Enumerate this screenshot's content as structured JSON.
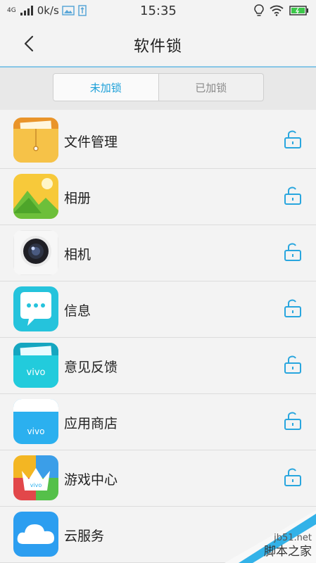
{
  "status_bar": {
    "network": "4G",
    "speed": "0k/s",
    "time": "15:35"
  },
  "header": {
    "title": "软件锁",
    "back_icon": "chevron-left-icon"
  },
  "tabs": [
    {
      "label": "未加锁",
      "active": true
    },
    {
      "label": "已加锁",
      "active": false
    }
  ],
  "apps": [
    {
      "name": "文件管理",
      "icon": "file-manager-icon",
      "locked": false
    },
    {
      "name": "相册",
      "icon": "gallery-icon",
      "locked": false
    },
    {
      "name": "相机",
      "icon": "camera-icon",
      "locked": false
    },
    {
      "name": "信息",
      "icon": "messages-icon",
      "locked": false
    },
    {
      "name": "意见反馈",
      "icon": "feedback-icon",
      "locked": false
    },
    {
      "name": "应用商店",
      "icon": "app-store-icon",
      "locked": false
    },
    {
      "name": "游戏中心",
      "icon": "game-center-icon",
      "locked": false
    },
    {
      "name": "云服务",
      "icon": "cloud-service-icon",
      "locked": false
    }
  ],
  "brand_text": "vivo",
  "watermark": {
    "site": "jb51.net",
    "name": "脚本之家"
  },
  "colors": {
    "accent": "#1a9fd8",
    "lock": "#29a6de"
  }
}
